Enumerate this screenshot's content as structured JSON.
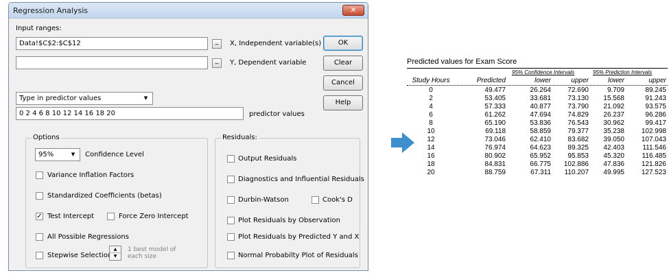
{
  "dialog": {
    "title": "Regression Analysis",
    "close_label": "✕",
    "input_ranges_label": "Input ranges:",
    "x_field_value": "Data!$C$2:$C$12",
    "x_label": "X, Independent variable(s)",
    "y_field_value": "",
    "y_label": "Y, Dependent variable",
    "range_btn_label": "_",
    "buttons": {
      "ok": "OK",
      "clear": "Clear",
      "cancel": "Cancel",
      "help": "Help"
    },
    "predictor_mode": "Type in predictor values",
    "predictor_values": "0 2 4 6 8 10 12 14 16 18 20",
    "predictor_values_label": "predictor values",
    "options": {
      "title": "Options",
      "confidence_value": "95%",
      "confidence_label": "Confidence Level",
      "vif_label": "Variance Inflation Factors",
      "vif_checked": false,
      "std_coef_label": "Standardized Coefficients (betas)",
      "std_coef_checked": false,
      "test_intercept_label": "Test Intercept",
      "test_intercept_checked": true,
      "force_zero_label": "Force Zero Intercept",
      "force_zero_checked": false,
      "all_possible_label": "All Possible Regressions",
      "all_possible_checked": false,
      "stepwise_label": "Stepwise Selection",
      "stepwise_checked": false,
      "stepwise_hint": "1 best model of each size"
    },
    "residuals": {
      "title": "Residuals:",
      "output_label": "Output Residuals",
      "diagnostics_label": "Diagnostics and Influential Residuals",
      "durbin_label": "Durbin-Watson",
      "cooks_label": "Cook's D",
      "by_obs_label": "Plot Residuals by Observation",
      "by_pred_label": "Plot Residuals by Predicted Y and X",
      "normal_label": "Normal Probabilty Plot of Residuals"
    }
  },
  "result": {
    "title": "Predicted values for Exam Score",
    "group_confidence": "95% Confidence Intervals",
    "group_prediction": "95% Prediction Intervals",
    "columns": [
      "Study Hours",
      "Predicted",
      "lower",
      "upper",
      "lower",
      "upper"
    ],
    "rows": [
      [
        "0",
        "49.477",
        "26.264",
        "72.690",
        "9.709",
        "89.245"
      ],
      [
        "2",
        "53.405",
        "33.681",
        "73.130",
        "15.568",
        "91.243"
      ],
      [
        "4",
        "57.333",
        "40.877",
        "73.790",
        "21.092",
        "93.575"
      ],
      [
        "6",
        "61.262",
        "47.694",
        "74.829",
        "26.237",
        "96.286"
      ],
      [
        "8",
        "65.190",
        "53.836",
        "76.543",
        "30.962",
        "99.417"
      ],
      [
        "10",
        "69.118",
        "58.859",
        "79.377",
        "35.238",
        "102.998"
      ],
      [
        "12",
        "73.046",
        "62.410",
        "83.682",
        "39.050",
        "107.043"
      ],
      [
        "14",
        "76.974",
        "64.623",
        "89.325",
        "42.403",
        "111.546"
      ],
      [
        "16",
        "80.902",
        "65.952",
        "95.853",
        "45.320",
        "116.485"
      ],
      [
        "18",
        "84.831",
        "66.775",
        "102.886",
        "47.836",
        "121.826"
      ],
      [
        "20",
        "88.759",
        "67.311",
        "110.207",
        "49.995",
        "127.523"
      ]
    ]
  },
  "colors": {
    "arrow": "#3d8fce",
    "title_bar": "#c9daf0"
  }
}
